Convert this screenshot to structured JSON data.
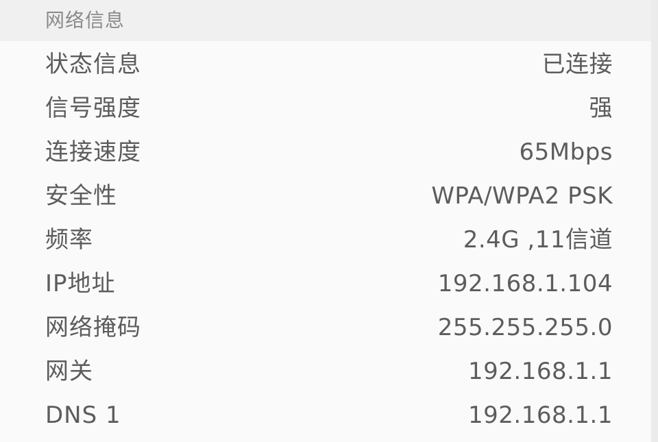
{
  "section": {
    "title": "网络信息"
  },
  "rows": [
    {
      "label": "状态信息",
      "value": "已连接"
    },
    {
      "label": "信号强度",
      "value": "强"
    },
    {
      "label": "连接速度",
      "value": "65Mbps"
    },
    {
      "label": "安全性",
      "value": "WPA/WPA2 PSK"
    },
    {
      "label": "频率",
      "value": "2.4G ,11信道"
    },
    {
      "label": "IP地址",
      "value": "192.168.1.104"
    },
    {
      "label": "网络掩码",
      "value": "255.255.255.0"
    },
    {
      "label": "网关",
      "value": "192.168.1.1"
    },
    {
      "label": "DNS 1",
      "value": "192.168.1.1"
    }
  ]
}
